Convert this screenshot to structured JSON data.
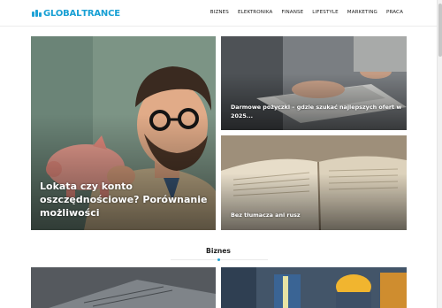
{
  "header": {
    "logo": {
      "prefix": "GLOBAL",
      "suffix": "TRANCE"
    },
    "nav": [
      "BIZNES",
      "ELEKTRONIKA",
      "FINANSE",
      "LIFESTYLE",
      "MARKETING",
      "PRACA"
    ]
  },
  "featured": [
    {
      "title": "Lokata czy konto oszczędnościowe? Porównanie możliwości"
    },
    {
      "title": "Darmowe pożyczki – gdzie szukać najlepszych ofert w 2025..."
    },
    {
      "title": "Bez tłumacza ani rusz"
    }
  ],
  "section": {
    "title": "Biznes"
  },
  "colors": {
    "accent": "#1ea2d6"
  }
}
